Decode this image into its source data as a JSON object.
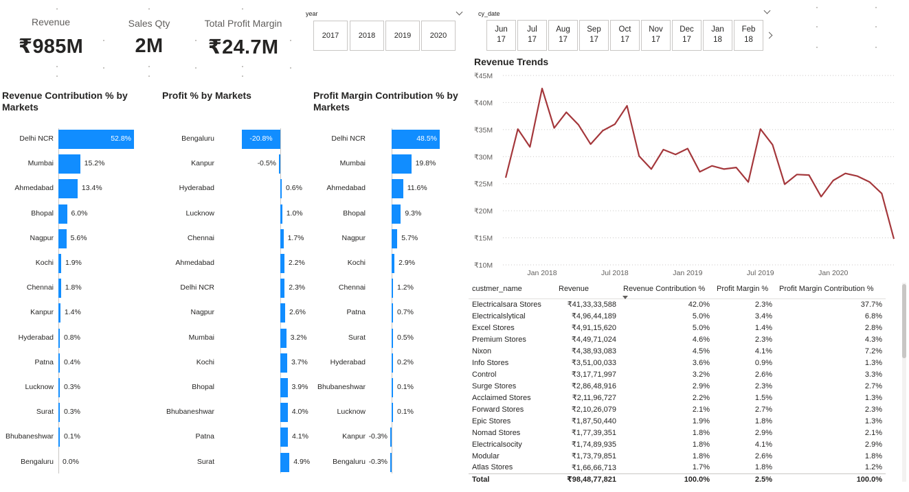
{
  "kpis": [
    {
      "label": "Revenue",
      "value": "₹985M"
    },
    {
      "label": "Sales Qty",
      "value": "2M"
    },
    {
      "label": "Total Profit Margin",
      "value": "₹24.7M"
    }
  ],
  "year_slicer": {
    "title": "year",
    "options": [
      "2017",
      "2018",
      "2019",
      "2020"
    ]
  },
  "date_slicer": {
    "title": "cy_date",
    "options": [
      {
        "month": "Jun",
        "year": "17"
      },
      {
        "month": "Jul",
        "year": "17"
      },
      {
        "month": "Aug",
        "year": "17"
      },
      {
        "month": "Sep",
        "year": "17"
      },
      {
        "month": "Oct",
        "year": "17"
      },
      {
        "month": "Nov",
        "year": "17"
      },
      {
        "month": "Dec",
        "year": "17"
      },
      {
        "month": "Jan",
        "year": "18"
      },
      {
        "month": "Feb",
        "year": "18"
      }
    ]
  },
  "colors": {
    "bar": "#118dff",
    "line": "#a4373b",
    "grid": "#c8c6c4"
  },
  "chart_data": [
    {
      "type": "bar",
      "title": "Revenue Contribution % by Markets",
      "categories": [
        "Delhi NCR",
        "Mumbai",
        "Ahmedabad",
        "Bhopal",
        "Nagpur",
        "Kochi",
        "Chennai",
        "Kanpur",
        "Hyderabad",
        "Patna",
        "Lucknow",
        "Surat",
        "Bhubaneshwar",
        "Bengaluru"
      ],
      "values": [
        52.8,
        15.2,
        13.4,
        6.0,
        5.6,
        1.9,
        1.8,
        1.4,
        0.8,
        0.4,
        0.3,
        0.3,
        0.1,
        0.0
      ],
      "labels": [
        "52.8%",
        "15.2%",
        "13.4%",
        "6.0%",
        "5.6%",
        "1.9%",
        "1.8%",
        "1.4%",
        "0.8%",
        "0.4%",
        "0.3%",
        "0.3%",
        "0.1%",
        "0.0%"
      ]
    },
    {
      "type": "bar",
      "title": "Profit % by Markets",
      "categories": [
        "Bengaluru",
        "Kanpur",
        "Hyderabad",
        "Lucknow",
        "Chennai",
        "Ahmedabad",
        "Delhi NCR",
        "Nagpur",
        "Mumbai",
        "Kochi",
        "Bhopal",
        "Bhubaneshwar",
        "Patna",
        "Surat"
      ],
      "values": [
        -20.8,
        -0.5,
        0.6,
        1.0,
        1.7,
        2.2,
        2.3,
        2.6,
        3.2,
        3.7,
        3.9,
        4.0,
        4.1,
        4.9
      ],
      "labels": [
        "-20.8%",
        "-0.5%",
        "0.6%",
        "1.0%",
        "1.7%",
        "2.2%",
        "2.3%",
        "2.6%",
        "3.2%",
        "3.7%",
        "3.9%",
        "4.0%",
        "4.1%",
        "4.9%"
      ]
    },
    {
      "type": "bar",
      "title": "Profit Margin Contribution % by Markets",
      "categories": [
        "Delhi NCR",
        "Mumbai",
        "Ahmedabad",
        "Bhopal",
        "Nagpur",
        "Kochi",
        "Chennai",
        "Patna",
        "Surat",
        "Hyderabad",
        "Bhubaneshwar",
        "Lucknow",
        "Kanpur",
        "Bengaluru"
      ],
      "values": [
        48.5,
        19.8,
        11.6,
        9.3,
        5.7,
        2.9,
        1.2,
        0.7,
        0.5,
        0.2,
        0.1,
        0.1,
        -0.3,
        -0.3
      ],
      "labels": [
        "48.5%",
        "19.8%",
        "11.6%",
        "9.3%",
        "5.7%",
        "2.9%",
        "1.2%",
        "0.7%",
        "0.5%",
        "0.2%",
        "0.1%",
        "0.1%",
        "-0.3%",
        "-0.3%"
      ]
    },
    {
      "type": "line",
      "title": "Revenue Trends",
      "ylim": [
        10,
        45
      ],
      "yticks": [
        "₹45M",
        "₹40M",
        "₹35M",
        "₹30M",
        "₹25M",
        "₹20M",
        "₹15M",
        "₹10M"
      ],
      "xticks": [
        "Jan 2018",
        "Jul 2018",
        "Jan 2019",
        "Jul 2019",
        "Jan 2020"
      ],
      "x": [
        "2017-10",
        "2017-11",
        "2017-12",
        "2018-01",
        "2018-02",
        "2018-03",
        "2018-04",
        "2018-05",
        "2018-06",
        "2018-07",
        "2018-08",
        "2018-09",
        "2018-10",
        "2018-11",
        "2018-12",
        "2019-01",
        "2019-02",
        "2019-03",
        "2019-04",
        "2019-05",
        "2019-06",
        "2019-07",
        "2019-08",
        "2019-09",
        "2019-10",
        "2019-11",
        "2019-12",
        "2020-01",
        "2020-02",
        "2020-03",
        "2020-04",
        "2020-05",
        "2020-06"
      ],
      "series": [
        {
          "values": [
            26.1,
            35.1,
            31.8,
            42.6,
            35.3,
            38.2,
            35.9,
            32.3,
            34.8,
            36.0,
            39.4,
            30.1,
            27.7,
            31.3,
            30.4,
            31.5,
            27.2,
            28.3,
            27.7,
            28.0,
            25.3,
            35.1,
            32.2,
            24.9,
            26.7,
            26.6,
            22.6,
            25.6,
            26.9,
            26.4,
            25.3,
            23.2,
            14.8
          ]
        }
      ]
    }
  ],
  "table": {
    "columns": [
      "custmer_name",
      "Revenue",
      "Revenue Contribution %",
      "Profit Margin %",
      "Profit Margin Contribution %"
    ],
    "rows": [
      [
        "Electricalsara Stores",
        "₹41,33,33,588",
        "42.0%",
        "2.3%",
        "37.7%"
      ],
      [
        "Electricalslytical",
        "₹4,96,44,189",
        "5.0%",
        "3.4%",
        "6.8%"
      ],
      [
        "Excel Stores",
        "₹4,91,15,620",
        "5.0%",
        "1.4%",
        "2.8%"
      ],
      [
        "Premium Stores",
        "₹4,49,71,024",
        "4.6%",
        "2.3%",
        "4.3%"
      ],
      [
        "Nixon",
        "₹4,38,93,083",
        "4.5%",
        "4.1%",
        "7.2%"
      ],
      [
        "Info Stores",
        "₹3,51,00,033",
        "3.6%",
        "0.9%",
        "1.3%"
      ],
      [
        "Control",
        "₹3,17,71,997",
        "3.2%",
        "2.6%",
        "3.3%"
      ],
      [
        "Surge Stores",
        "₹2,86,48,916",
        "2.9%",
        "2.3%",
        "2.7%"
      ],
      [
        "Acclaimed Stores",
        "₹2,11,96,727",
        "2.2%",
        "1.5%",
        "1.3%"
      ],
      [
        "Forward Stores",
        "₹2,10,26,079",
        "2.1%",
        "2.7%",
        "2.3%"
      ],
      [
        "Epic Stores",
        "₹1,87,50,440",
        "1.9%",
        "1.8%",
        "1.3%"
      ],
      [
        "Nomad Stores",
        "₹1,77,39,351",
        "1.8%",
        "2.9%",
        "2.1%"
      ],
      [
        "Electricalsocity",
        "₹1,74,89,935",
        "1.8%",
        "4.1%",
        "2.9%"
      ],
      [
        "Modular",
        "₹1,73,79,851",
        "1.8%",
        "2.6%",
        "1.8%"
      ],
      [
        "Atlas Stores",
        "₹1,66,66,713",
        "1.7%",
        "1.8%",
        "1.2%"
      ]
    ],
    "total": [
      "Total",
      "₹98,48,77,821",
      "100.0%",
      "2.5%",
      "100.0%"
    ]
  }
}
